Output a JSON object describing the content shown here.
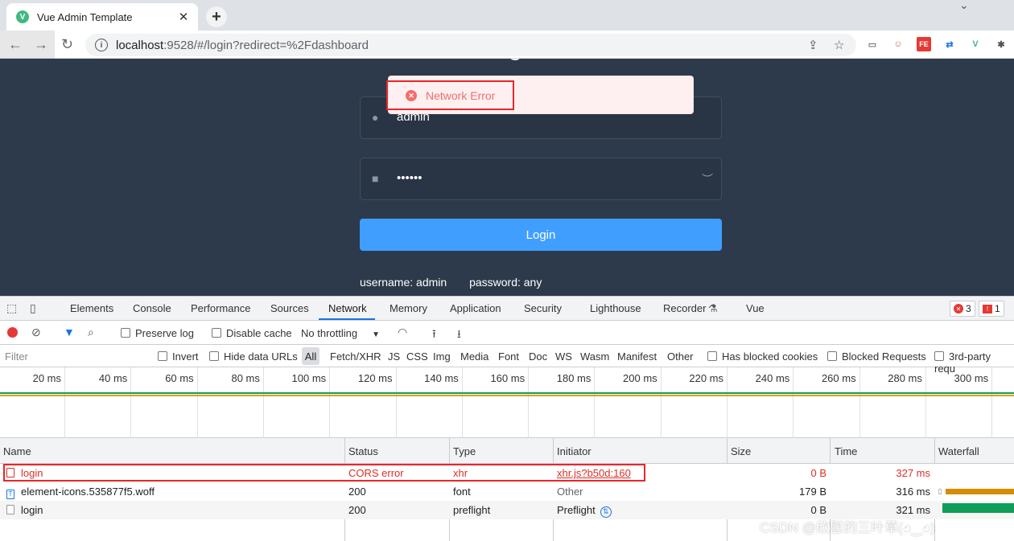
{
  "browser": {
    "tab_title": "Vue Admin Template",
    "tab_favicon": "V",
    "close_glyph": "✕",
    "new_tab_glyph": "+",
    "url_host": "localhost",
    "url_rest": ":9528/#/login?redirect=%2Fdashboard"
  },
  "login_page": {
    "username_value": "admin",
    "password_value": "••••••",
    "login_button": "Login",
    "tip_username": "username: admin",
    "tip_password": "password: any",
    "toast_message": "Network Error",
    "toast_color": "#f56c6c",
    "button_color": "#409eff",
    "background_color": "#2d3a4b"
  },
  "devtools": {
    "tabs": [
      "Elements",
      "Console",
      "Performance",
      "Sources",
      "Network",
      "Memory",
      "Application",
      "Security",
      "Lighthouse",
      "Recorder",
      "Vue"
    ],
    "active_tab": "Network",
    "error_count": "3",
    "issue_count": "1",
    "toolbar": {
      "preserve_log": "Preserve log",
      "disable_cache": "Disable cache",
      "throttling": "No throttling"
    },
    "filter": {
      "placeholder": "Filter",
      "invert": "Invert",
      "hide_data_urls": "Hide data URLs",
      "types": [
        "All",
        "Fetch/XHR",
        "JS",
        "CSS",
        "Img",
        "Media",
        "Font",
        "Doc",
        "WS",
        "Wasm",
        "Manifest",
        "Other"
      ],
      "has_blocked_cookies": "Has blocked cookies",
      "blocked_requests": "Blocked Requests",
      "third_party": "3rd-party requ"
    },
    "timeline_ticks": [
      "20 ms",
      "40 ms",
      "60 ms",
      "80 ms",
      "100 ms",
      "120 ms",
      "140 ms",
      "160 ms",
      "180 ms",
      "200 ms",
      "220 ms",
      "240 ms",
      "260 ms",
      "280 ms",
      "300 ms"
    ],
    "columns": [
      "Name",
      "Status",
      "Type",
      "Initiator",
      "Size",
      "Time",
      "Waterfall"
    ],
    "rows": [
      {
        "name": "login",
        "status": "CORS error",
        "type": "xhr",
        "initiator": "xhr.js?b50d:160",
        "size": "0 B",
        "time": "327 ms",
        "error": true
      },
      {
        "name": "element-icons.535877f5.woff",
        "status": "200",
        "type": "font",
        "initiator": "Other",
        "size": "179 B",
        "time": "316 ms",
        "error": false
      },
      {
        "name": "login",
        "status": "200",
        "type": "preflight",
        "initiator": "Preflight",
        "size": "0 B",
        "time": "321 ms",
        "error": false
      }
    ]
  },
  "watermark": "CSDN @欣慰的三叶草(◕‿◕)"
}
